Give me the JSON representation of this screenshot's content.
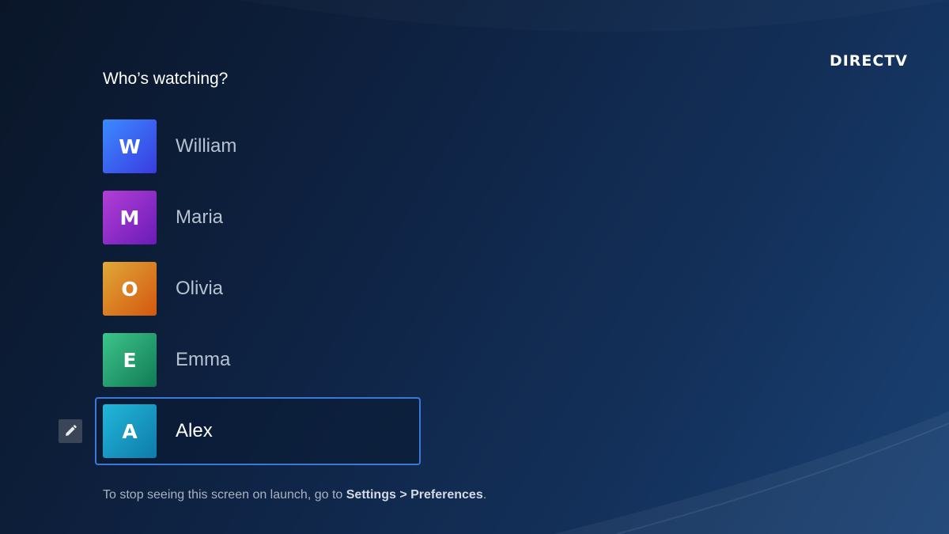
{
  "brand": {
    "logo_text": "DIRECTV"
  },
  "header": {
    "title": "Who’s watching?"
  },
  "profiles": [
    {
      "initial": "W",
      "name": "William",
      "color_from": "#3b8bff",
      "color_to": "#3a3be0"
    },
    {
      "initial": "M",
      "name": "Maria",
      "color_from": "#b23fd6",
      "color_to": "#6a1bb8"
    },
    {
      "initial": "O",
      "name": "Olivia",
      "color_from": "#e0a838",
      "color_to": "#d4570f"
    },
    {
      "initial": "E",
      "name": "Emma",
      "color_from": "#3cc58a",
      "color_to": "#117a55"
    },
    {
      "initial": "A",
      "name": "Alex",
      "color_from": "#22b7d8",
      "color_to": "#0e7bab",
      "selected": true
    }
  ],
  "footer": {
    "prefix": "To stop seeing this screen on launch, go to ",
    "link": "Settings > Preferences",
    "suffix": "."
  },
  "colors": {
    "focus_border": "#3b78d8",
    "background_dark": "#0a1628",
    "background_light": "#1a4274"
  },
  "icons": {
    "edit": "pencil-icon"
  }
}
